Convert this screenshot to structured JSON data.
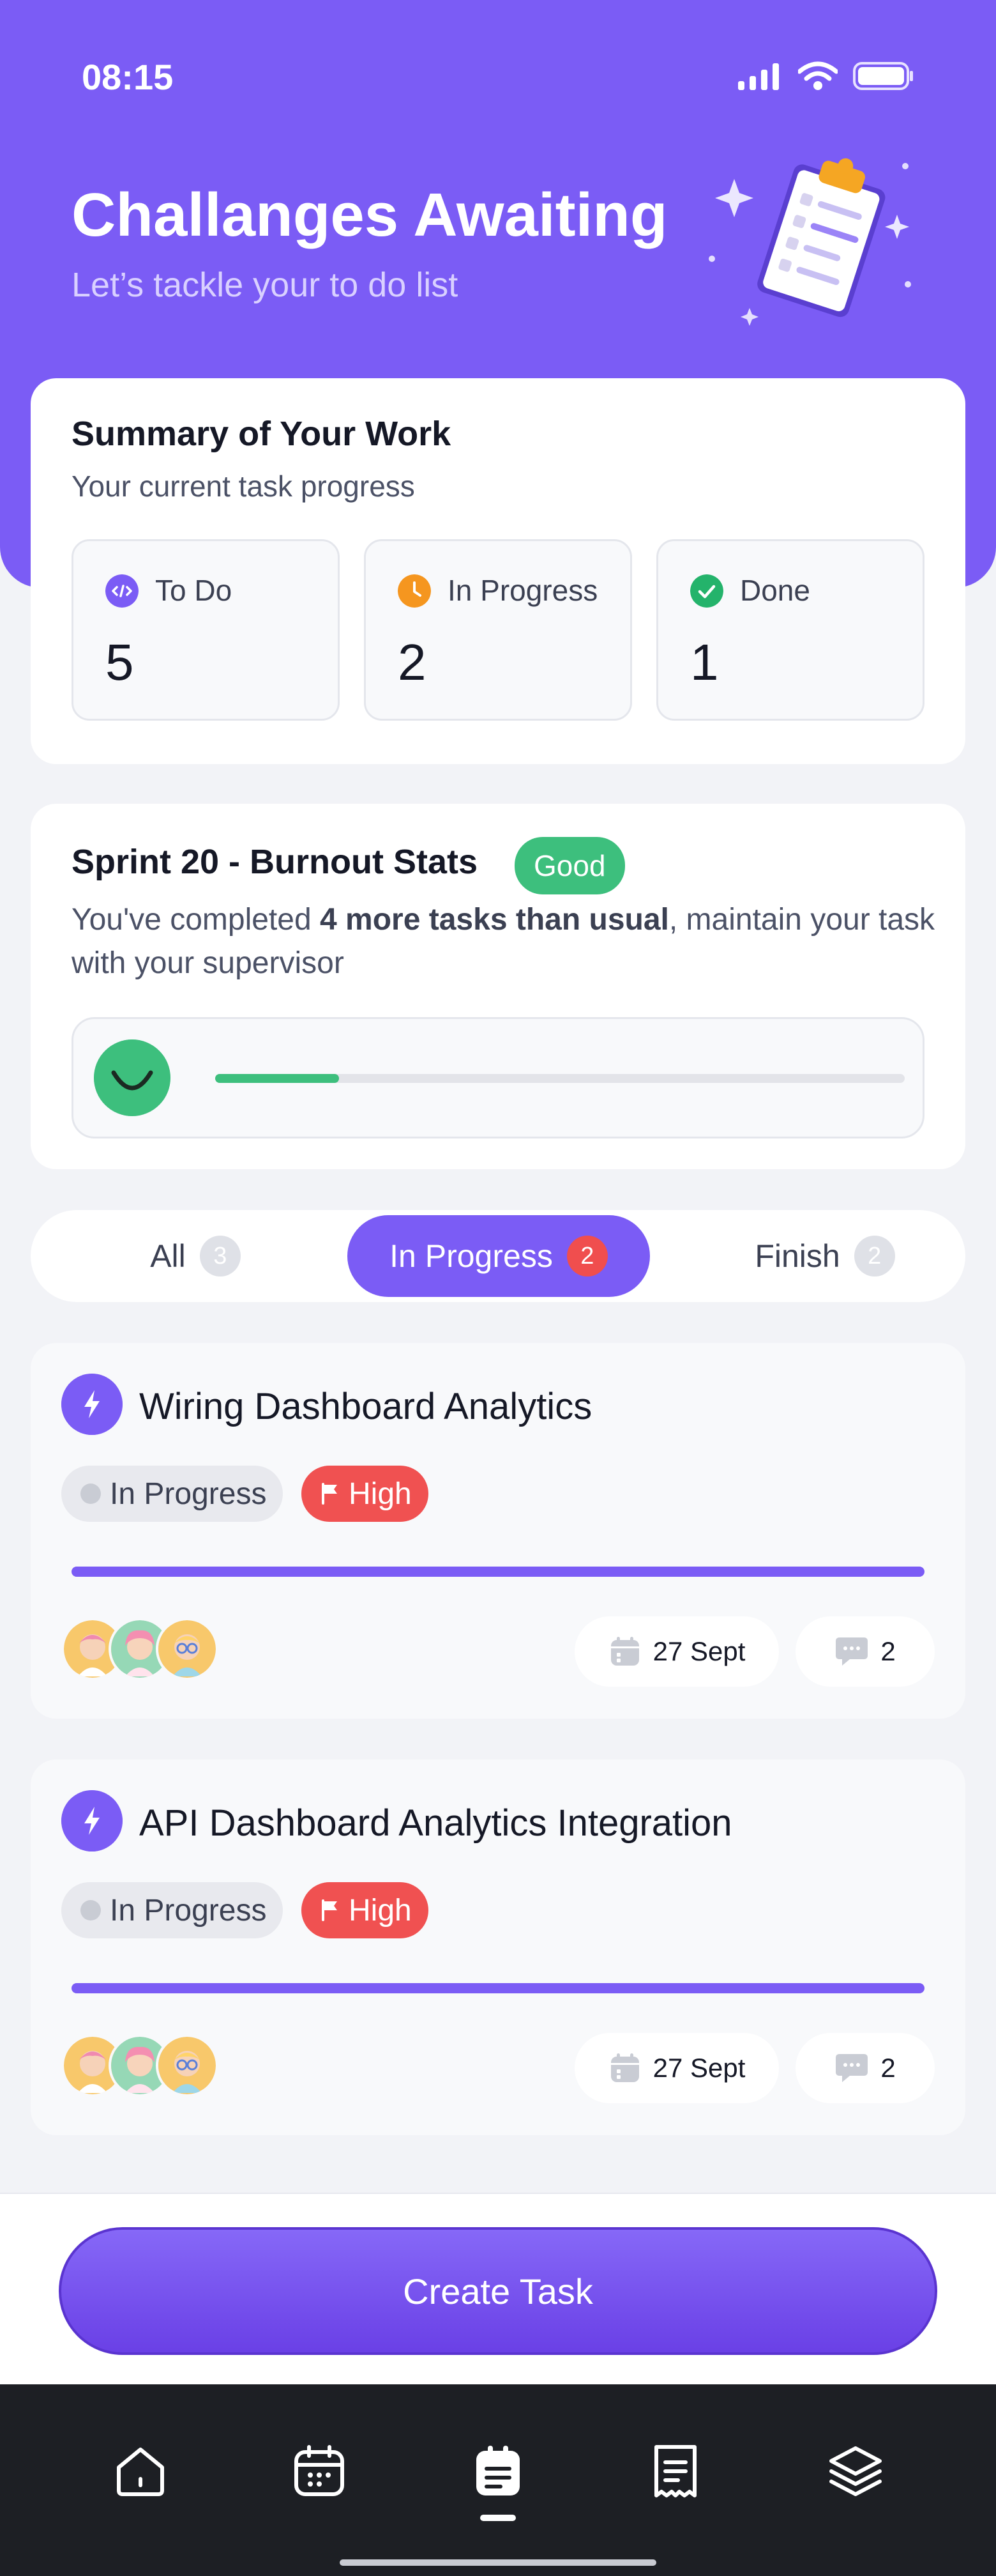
{
  "status_bar": {
    "time": "08:15"
  },
  "hero": {
    "title": "Challanges Awaiting",
    "subtitle": "Let’s tackle your to do list"
  },
  "summary": {
    "title": "Summary of Your Work",
    "subtitle": "Your current task progress",
    "stats": [
      {
        "label": "To Do",
        "value": "5",
        "icon": "code-icon",
        "color": "#7b5cf5"
      },
      {
        "label": "In Progress",
        "value": "2",
        "icon": "clock-icon",
        "color": "#f5961f"
      },
      {
        "label": "Done",
        "value": "1",
        "icon": "check-icon",
        "color": "#24b36b"
      }
    ]
  },
  "burnout": {
    "title": "Sprint 20 - Burnout Stats",
    "badge": "Good",
    "desc_prefix": "You've completed ",
    "desc_bold": "4 more tasks than usual",
    "desc_suffix": ", maintain your task with your supervisor",
    "progress": 0.18,
    "mood": "smile-icon"
  },
  "tabs": [
    {
      "label": "All",
      "count": "3",
      "active": false
    },
    {
      "label": "In Progress",
      "count": "2",
      "active": true
    },
    {
      "label": "Finish",
      "count": "2",
      "active": false
    }
  ],
  "tasks": [
    {
      "title": "Wiring Dashboard Analytics",
      "status": "In Progress",
      "priority": "High",
      "date": "27 Sept",
      "comments": "2",
      "progress": 1.0
    },
    {
      "title": "API Dashboard Analytics Integration",
      "status": "In Progress",
      "priority": "High",
      "date": "27 Sept",
      "comments": "2",
      "progress": 1.0
    }
  ],
  "create_button": "Create Task",
  "nav": [
    {
      "icon": "home-icon",
      "active": false
    },
    {
      "icon": "calendar-icon",
      "active": false
    },
    {
      "icon": "clipboard-icon",
      "active": true
    },
    {
      "icon": "receipt-icon",
      "active": false
    },
    {
      "icon": "layers-icon",
      "active": false
    }
  ],
  "colors": {
    "primary": "#7b5cf5",
    "success": "#3dbf7d",
    "danger": "#f05151",
    "background": "#f2f3f7"
  }
}
